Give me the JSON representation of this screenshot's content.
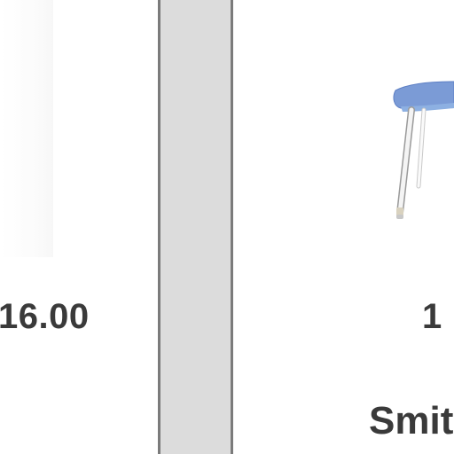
{
  "products": [
    {
      "price": "16.00"
    },
    {
      "price": "1",
      "brand": "Smit",
      "image_icon": "chair-icon",
      "seat_color": "#7b9bd6"
    }
  ],
  "divider": {
    "color": "#dcdcdc",
    "border_color": "#7b7b7b"
  }
}
